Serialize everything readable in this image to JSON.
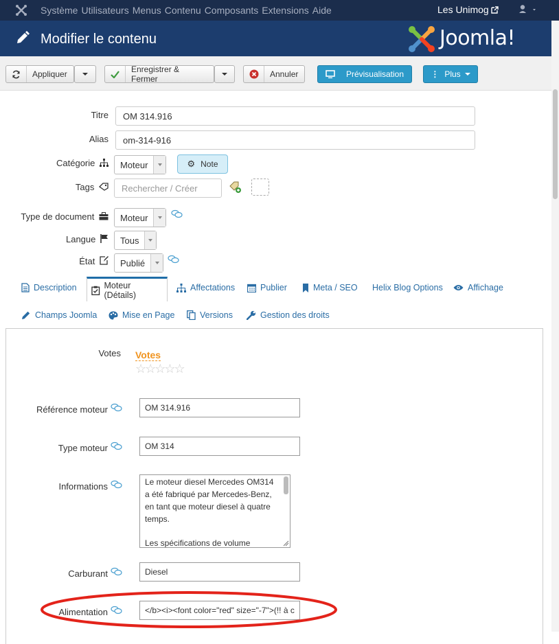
{
  "topbar": {
    "menu": [
      "Système",
      "Utilisateurs",
      "Menus",
      "Contenu",
      "Composants",
      "Extensions",
      "Aide"
    ],
    "site_name": "Les Unimog"
  },
  "header": {
    "title": "Modifier le contenu",
    "brand": "Joomla!"
  },
  "toolbar": {
    "apply": "Appliquer",
    "save_close": "Enregistrer & Fermer",
    "cancel": "Annuler",
    "preview": "Prévisualisation",
    "more": "Plus"
  },
  "form": {
    "title_label": "Titre",
    "title_value": "OM 314.916",
    "alias_label": "Alias",
    "alias_value": "om-314-916",
    "category_label": "Catégorie",
    "category_value": "Moteur",
    "note_button": "Note",
    "tags_label": "Tags",
    "tags_placeholder": "Rechercher / Créer",
    "doctype_label": "Type de document",
    "doctype_value": "Moteur",
    "language_label": "Langue",
    "language_value": "Tous",
    "state_label": "État",
    "state_value": "Publié"
  },
  "tabs": {
    "row1": [
      "Description",
      "Moteur (Détails)",
      "Affectations",
      "Publier",
      "Meta / SEO",
      "Helix Blog Options",
      "Affichage"
    ],
    "row2": [
      "Champs Joomla",
      "Mise en Page",
      "Versions",
      "Gestion des droits"
    ]
  },
  "fields": {
    "votes_label": "Votes",
    "votes_link": "Votes",
    "ref_label": "Référence moteur",
    "ref_value": "OM 314.916",
    "type_label": "Type moteur",
    "type_value": "OM 314",
    "info_label": "Informations",
    "info_lines": [
      "Le moteur diesel Mercedes OM314",
      "a été fabriqué par Mercedes-Benz,",
      "en tant que moteur diesel à quatre",
      "temps.",
      "",
      "Les spécifications de volume"
    ],
    "fuel_label": "Carburant",
    "fuel_value": "Diesel",
    "supply_label": "Alimentation",
    "supply_value": "</b><i><font color=\"red\" size=\"-7\">(!! à c"
  },
  "colors": {
    "topbar": "#1b2d4c",
    "header": "#1c3d6e",
    "accent": "#2c9ac9",
    "link": "#2a6da5",
    "votes": "#f0931e",
    "highlight": "#e3231a"
  }
}
